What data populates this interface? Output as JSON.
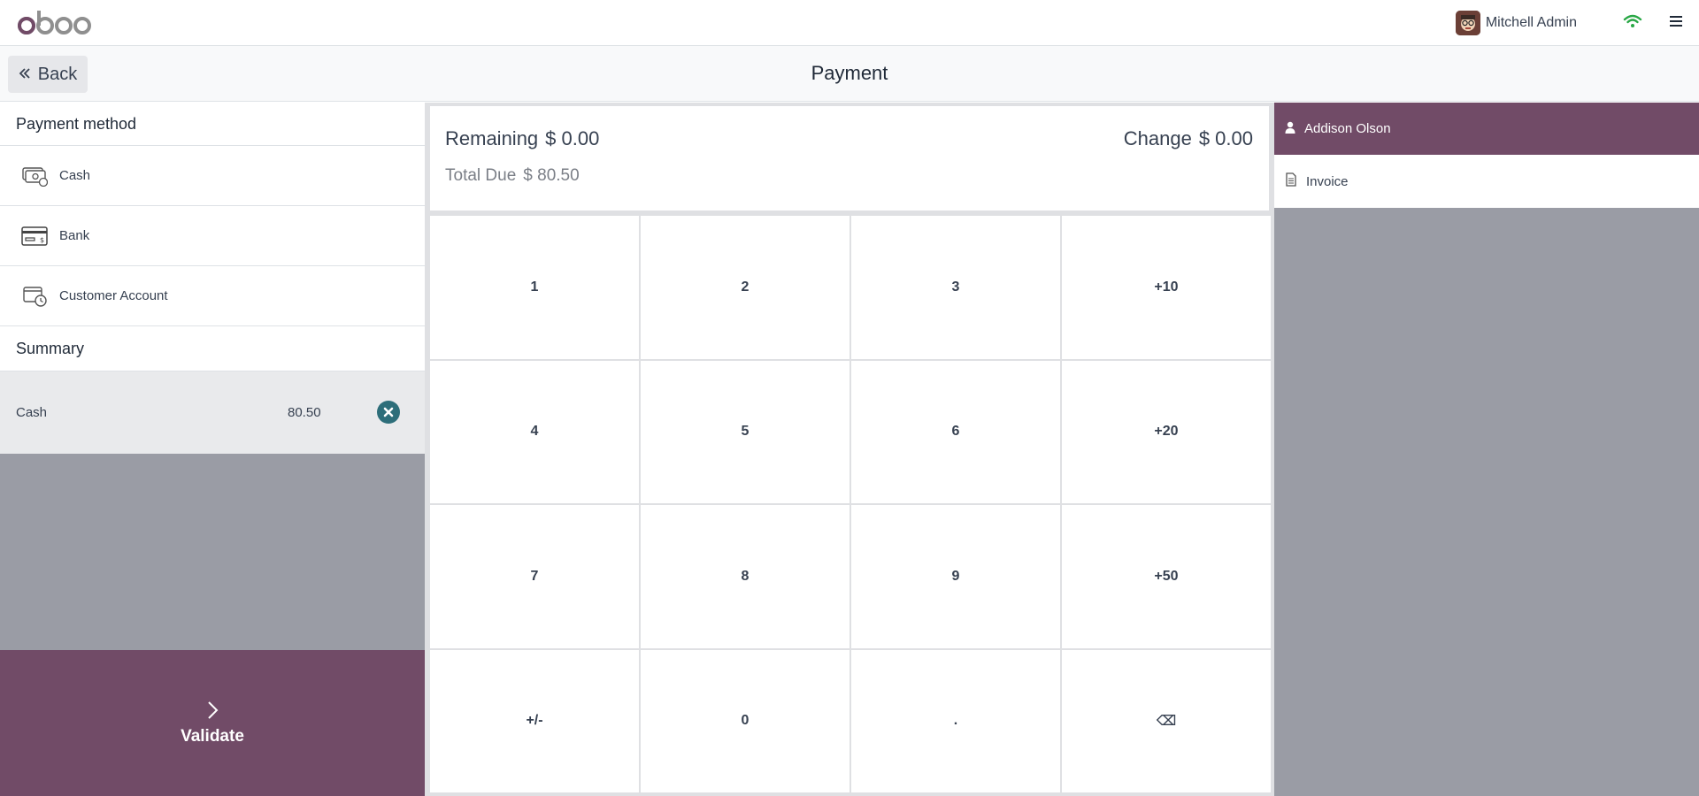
{
  "topbar": {
    "logo_text": "odoo",
    "user_name": "Mitchell Admin"
  },
  "header": {
    "back_label": "Back",
    "title": "Payment"
  },
  "payment_methods": {
    "title": "Payment method",
    "items": [
      {
        "label": "Cash",
        "icon": "cash-icon"
      },
      {
        "label": "Bank",
        "icon": "bank-card-icon"
      },
      {
        "label": "Customer Account",
        "icon": "customer-account-icon"
      }
    ]
  },
  "summary": {
    "title": "Summary",
    "lines": [
      {
        "method": "Cash",
        "amount": "80.50"
      }
    ]
  },
  "validate": {
    "label": "Validate"
  },
  "amounts": {
    "remaining_label": "Remaining",
    "remaining_value": "$ 0.00",
    "change_label": "Change",
    "change_value": "$ 0.00",
    "total_due_label": "Total Due",
    "total_due_value": "$ 80.50"
  },
  "numpad": {
    "keys": [
      "1",
      "2",
      "3",
      "+10",
      "4",
      "5",
      "6",
      "+20",
      "7",
      "8",
      "9",
      "+50",
      "+/-",
      "0",
      ".",
      "⌫"
    ]
  },
  "customer_panel": {
    "customer_name": "Addison Olson",
    "invoice_label": "Invoice"
  },
  "colors": {
    "brand": "#714b67",
    "panel_gray": "#9a9ca5",
    "remove_teal": "#2d6e7a",
    "wifi_green": "#28a745"
  }
}
